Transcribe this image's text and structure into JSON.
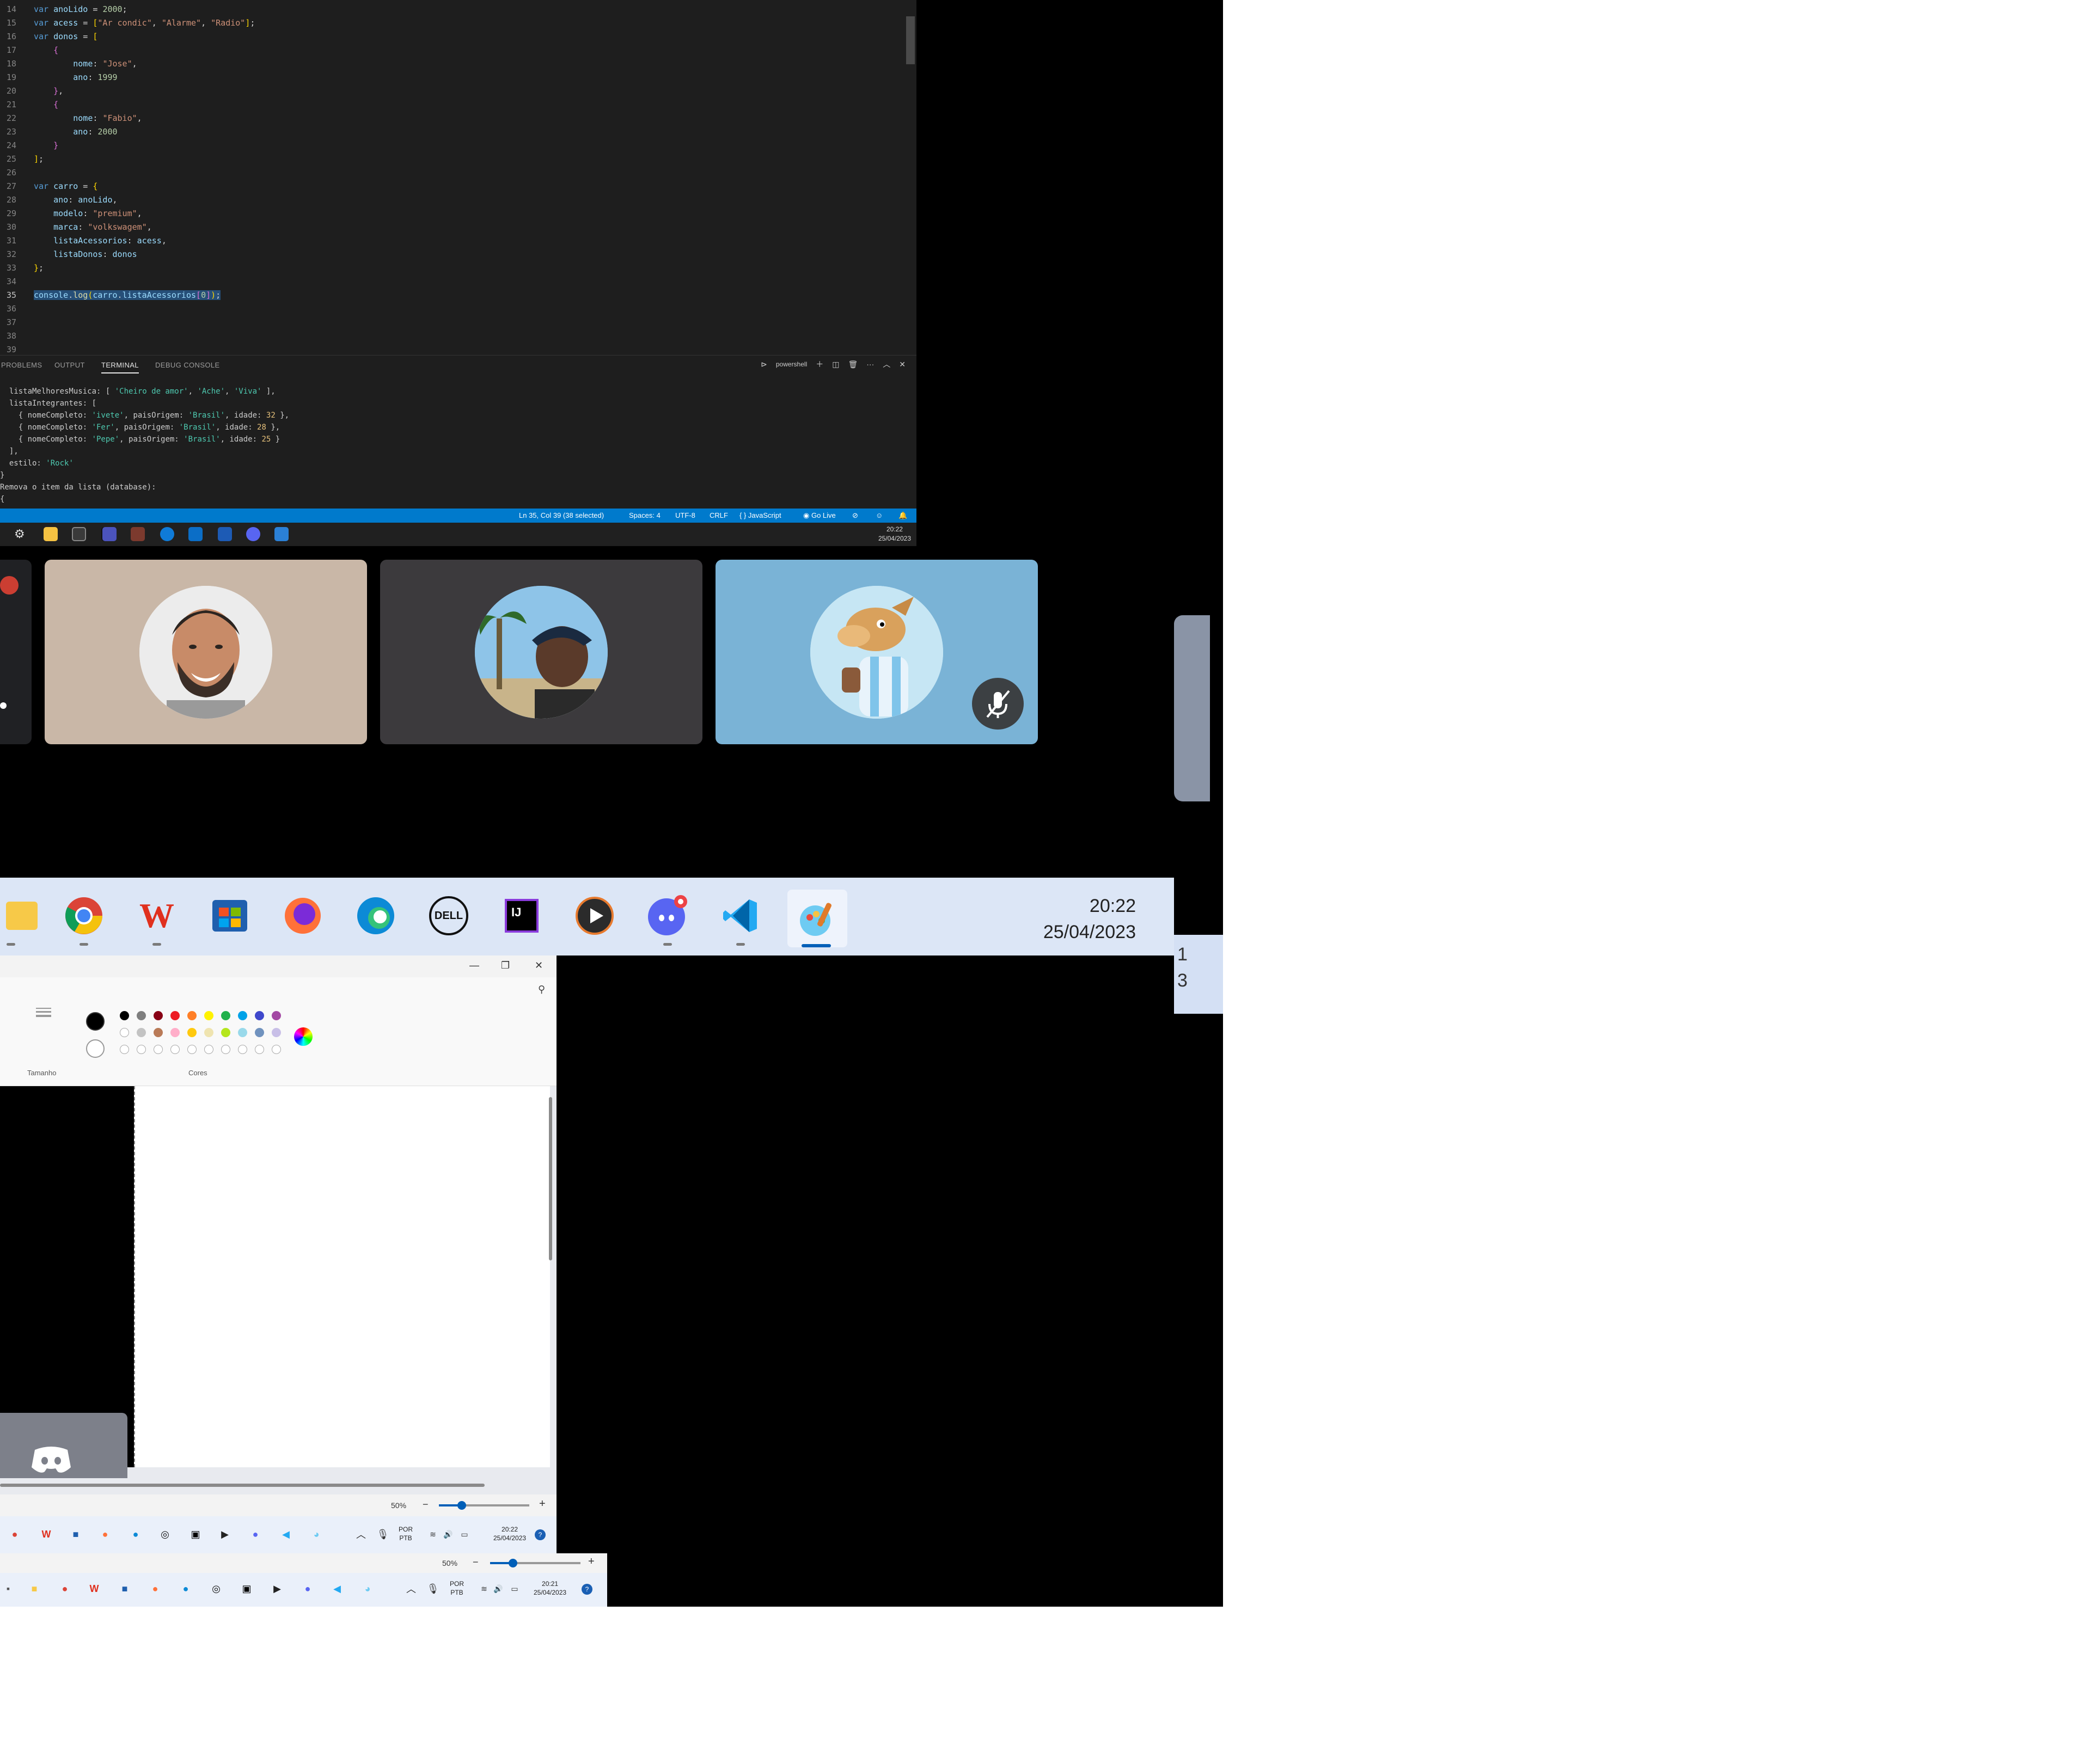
{
  "editor": {
    "lines": [
      {
        "n": "14",
        "html": "<span class='tok-kw'>var</span> <span class='tok-var'>anoLido</span> = <span class='tok-num'>2000</span>;"
      },
      {
        "n": "15",
        "html": "<span class='tok-kw'>var</span> <span class='tok-var'>acess</span> = <span class='tok-br'>[</span><span class='tok-str'>\"Ar condic\"</span>, <span class='tok-str'>\"Alarme\"</span>, <span class='tok-str'>\"Radio\"</span><span class='tok-br'>]</span>;"
      },
      {
        "n": "16",
        "html": "<span class='tok-kw'>var</span> <span class='tok-var'>donos</span> = <span class='tok-br'>[</span>"
      },
      {
        "n": "17",
        "html": "    <span class='tok-br2'>{</span>"
      },
      {
        "n": "18",
        "html": "        <span class='tok-var'>nome</span>: <span class='tok-str'>\"Jose\"</span>,"
      },
      {
        "n": "19",
        "html": "        <span class='tok-var'>ano</span>: <span class='tok-num'>1999</span>"
      },
      {
        "n": "20",
        "html": "    <span class='tok-br2'>}</span>,"
      },
      {
        "n": "21",
        "html": "    <span class='tok-br2'>{</span>"
      },
      {
        "n": "22",
        "html": "        <span class='tok-var'>nome</span>: <span class='tok-str'>\"Fabio\"</span>,"
      },
      {
        "n": "23",
        "html": "        <span class='tok-var'>ano</span>: <span class='tok-num'>2000</span>"
      },
      {
        "n": "24",
        "html": "    <span class='tok-br2'>}</span>"
      },
      {
        "n": "25",
        "html": "<span class='tok-br'>]</span>;"
      },
      {
        "n": "26",
        "html": ""
      },
      {
        "n": "27",
        "html": "<span class='tok-kw'>var</span> <span class='tok-var'>carro</span> = <span class='tok-br'>{</span>"
      },
      {
        "n": "28",
        "html": "    <span class='tok-var'>ano</span>: <span class='tok-var'>anoLido</span>,"
      },
      {
        "n": "29",
        "html": "    <span class='tok-var'>modelo</span>: <span class='tok-str'>\"premium\"</span>,"
      },
      {
        "n": "30",
        "html": "    <span class='tok-var'>marca</span>: <span class='tok-str'>\"volkswagem\"</span>,"
      },
      {
        "n": "31",
        "html": "    <span class='tok-var'>listaAcessorios</span>: <span class='tok-var'>acess</span>,"
      },
      {
        "n": "32",
        "html": "    <span class='tok-var'>listaDonos</span>: <span class='tok-var'>donos</span>"
      },
      {
        "n": "33",
        "html": "<span class='tok-br'>}</span>;"
      },
      {
        "n": "34",
        "html": ""
      },
      {
        "n": "35",
        "html": "<span class='sel'><span class='tok-var'>console</span>.<span class='tok-fn'>log</span><span class='tok-br'>(</span><span class='tok-var'>carro</span>.<span class='tok-var'>listaAcessorios</span><span class='tok-br2'>[</span><span class='tok-num'>0</span><span class='tok-br2'>]</span><span class='tok-br'>)</span>;</span>",
        "active": true
      },
      {
        "n": "36",
        "html": ""
      },
      {
        "n": "37",
        "html": ""
      },
      {
        "n": "38",
        "html": ""
      },
      {
        "n": "39",
        "html": ""
      }
    ]
  },
  "panel": {
    "tabs": [
      "PROBLEMS",
      "OUTPUT",
      "TERMINAL",
      "DEBUG CONSOLE"
    ],
    "active_tab": "TERMINAL",
    "shell_label": "powershell"
  },
  "terminal": {
    "lines": [
      "  listaMelhoresMusica: [ <span class='t-str'>'Cheiro de amor'</span>, <span class='t-str'>'Ache'</span>, <span class='t-str'>'Viva'</span> ],",
      "  listaIntegrantes: [",
      "    { nomeCompleto: <span class='t-str'>'ivete'</span>, paisOrigem: <span class='t-str'>'Brasil'</span>, idade: <span class='t-num'>32</span> },",
      "    { nomeCompleto: <span class='t-str'>'Fer'</span>, paisOrigem: <span class='t-str'>'Brasil'</span>, idade: <span class='t-num'>28</span> },",
      "    { nomeCompleto: <span class='t-str'>'Pepe'</span>, paisOrigem: <span class='t-str'>'Brasil'</span>, idade: <span class='t-num'>25</span> }",
      "  ],",
      "  estilo: <span class='t-str'>'Rock'</span>",
      "}",
      "Remova o item da lista (database):",
      "{"
    ]
  },
  "statusbar": {
    "position": "Ln 35, Col 39 (38 selected)",
    "spaces": "Spaces: 4",
    "encoding": "UTF-8",
    "eol": "CRLF",
    "language": "{ } JavaScript",
    "golive": "Go Live"
  },
  "vs_taskbar": {
    "time": "20:22",
    "date": "25/04/2023"
  },
  "big_taskbar": {
    "time": "20:22",
    "date": "25/04/2023"
  },
  "side_notch": {
    "line1": "1",
    "line2": "3"
  },
  "paint": {
    "size_label": "Tamanho",
    "colors_label": "Cores",
    "zoom": "50%",
    "palette_row1": [
      "#000000",
      "#7f7f7f",
      "#880015",
      "#ed1c24",
      "#ff7f27",
      "#fff200",
      "#22b14c",
      "#00a2e8",
      "#3f48cc",
      "#a349a4"
    ],
    "palette_row2": [
      "#ffffff",
      "#c3c3c3",
      "#b97a57",
      "#ffaec9",
      "#ffc90e",
      "#efe4b0",
      "#b5e61d",
      "#99d9ea",
      "#7092be",
      "#c8bfe7"
    ]
  },
  "paint_taskbar": {
    "lang1": "POR",
    "lang2": "PTB",
    "time": "20:22",
    "date": "25/04/2023"
  },
  "strip": {
    "zoom": "50%",
    "lang1": "POR",
    "lang2": "PTB",
    "time": "20:21",
    "date": "25/04/2023"
  }
}
